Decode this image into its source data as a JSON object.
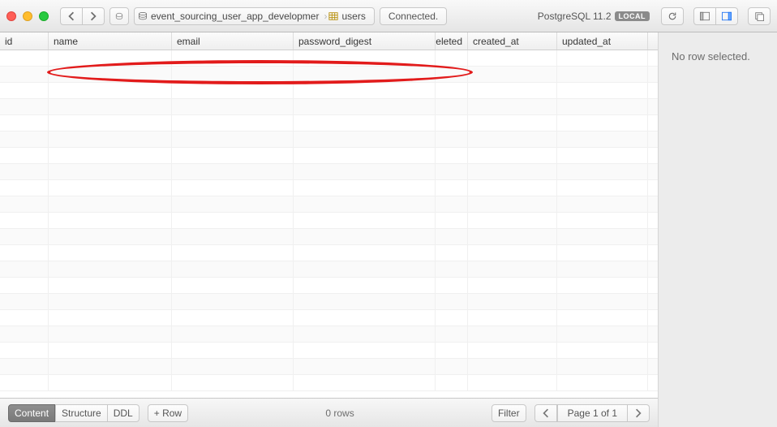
{
  "window": {
    "traffic": {
      "red": "#ff5f57",
      "yellow": "#ffbd2e",
      "green": "#28c940"
    }
  },
  "toolbar": {
    "database_name": "event_sourcing_user_app_developmer",
    "table_name": "users",
    "status": "Connected.",
    "db_version": "PostgreSQL 11.2",
    "local_badge": "LOCAL"
  },
  "columns": [
    {
      "key": "id",
      "label": "id"
    },
    {
      "key": "name",
      "label": "name"
    },
    {
      "key": "email",
      "label": "email"
    },
    {
      "key": "password_digest",
      "label": "password_digest"
    },
    {
      "key": "deleted",
      "label": "deleted"
    },
    {
      "key": "created_at",
      "label": "created_at"
    },
    {
      "key": "updated_at",
      "label": "updated_at"
    }
  ],
  "rows": [],
  "side_panel": {
    "message": "No row selected."
  },
  "footer": {
    "tabs": {
      "content": "Content",
      "structure": "Structure",
      "ddl": "DDL"
    },
    "add_row": "+ Row",
    "row_count": "0 rows",
    "filter": "Filter",
    "page_label": "Page 1 of 1"
  },
  "annotation": {
    "highlight_columns": [
      "name",
      "email",
      "password_digest",
      "deleted"
    ],
    "color": "#e21b1b"
  }
}
